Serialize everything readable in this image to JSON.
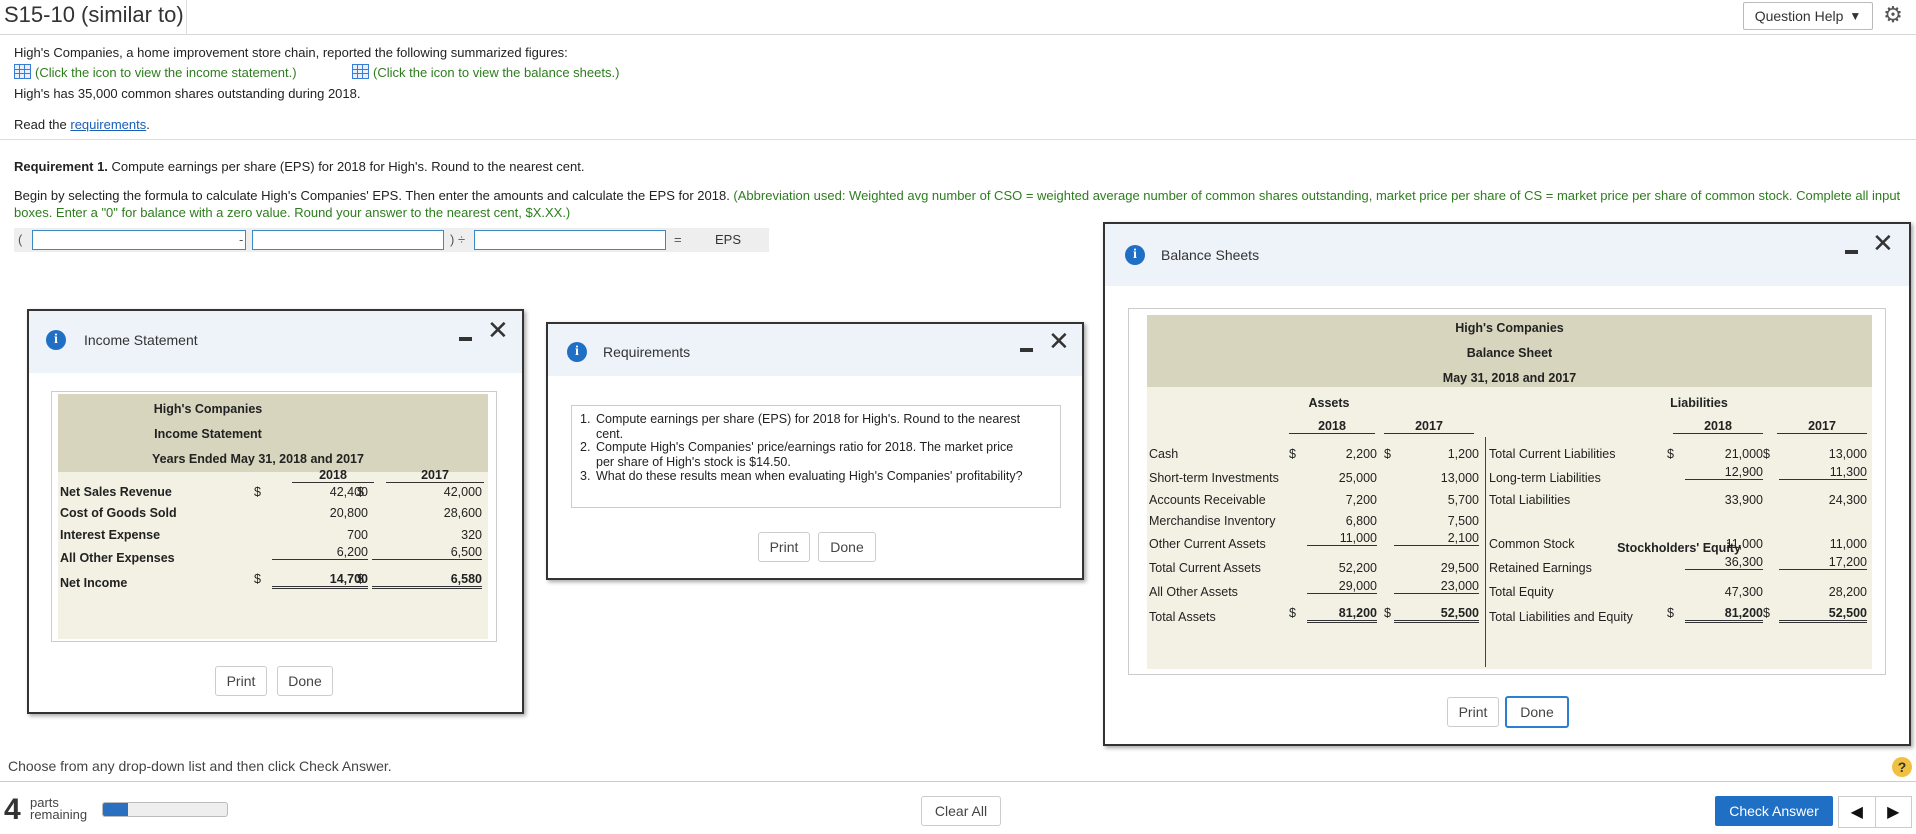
{
  "header": {
    "title": "S15-10 (similar to)",
    "question_help": "Question Help",
    "question_help_caret": "▼",
    "gear_icon": "⚙"
  },
  "problem": {
    "intro": "High's Companies, a home improvement store chain, reported the following summarized figures:",
    "link_income": "(Click the icon to view the income statement.)",
    "link_balance": "(Click the icon to view the balance sheets.)",
    "shares_text": "High's has 35,000 common shares outstanding during 2018.",
    "read_the": "Read the ",
    "requirements_link": "requirements",
    "period": "."
  },
  "requirement": {
    "label": "Requirement 1.",
    "text": " Compute earnings per share (EPS) for 2018 for High's. Round to the nearest cent.",
    "instr_black": "Begin by selecting the formula to calculate High's Companies' EPS. Then enter the amounts and calculate the EPS for 2018.",
    "instr_green_1": " (Abbreviation used: Weighted avg number of CSO = weighted average number of common shares outstanding, market price per share of CS = market price per share of common stock. Complete all input",
    "instr_green_2": "boxes. Enter a \"0\" for balance with a zero value. Round your answer to the nearest cent, $X.XX.)"
  },
  "formula": {
    "open_paren": "(",
    "minus": "-",
    "close_div": ") ÷",
    "equals": "=",
    "result_label": "EPS"
  },
  "income_dialog": {
    "title": "Income Statement",
    "company": "High's Companies",
    "statement": "Income Statement",
    "period": "Years Ended May 31, 2018 and 2017",
    "years": [
      "2018",
      "2017"
    ],
    "rows": [
      {
        "label": "Net Sales Revenue",
        "s1": "$",
        "v2018": "42,400",
        "s2": "$",
        "v2017": "42,000"
      },
      {
        "label": "Cost of Goods Sold",
        "s1": "",
        "v2018": "20,800",
        "s2": "",
        "v2017": "28,600"
      },
      {
        "label": "Interest Expense",
        "s1": "",
        "v2018": "700",
        "s2": "",
        "v2017": "320"
      },
      {
        "label": "All Other Expenses",
        "s1": "",
        "v2018": "6,200",
        "s2": "",
        "v2017": "6,500"
      },
      {
        "label": "Net Income",
        "s1": "$",
        "v2018": "14,700",
        "s2": "$",
        "v2017": "6,580"
      }
    ],
    "print": "Print",
    "done": "Done"
  },
  "requirements_dialog": {
    "title": "Requirements",
    "items": [
      {
        "num": "1.",
        "line1": "Compute earnings per share (EPS) for 2018 for High's. Round to the nearest",
        "line2": "cent."
      },
      {
        "num": "2.",
        "line1": "Compute High's Companies' price/earnings ratio for 2018. The market price",
        "line2": "per share of High's stock is $14.50."
      },
      {
        "num": "3.",
        "line1": "What do these results mean when evaluating High's Companies' profitability?",
        "line2": ""
      }
    ],
    "print": "Print",
    "done": "Done"
  },
  "balance_dialog": {
    "title": "Balance Sheets",
    "company": "High's Companies",
    "statement": "Balance Sheet",
    "period": "May 31, 2018 and 2017",
    "assets_header": "Assets",
    "liabilities_header": "Liabilities",
    "equity_header": "Stockholders' Equity",
    "years": [
      "2018",
      "2017"
    ],
    "assets": [
      {
        "label": "Cash",
        "s1": "$",
        "v2018": "2,200",
        "s2": "$",
        "v2017": "1,200"
      },
      {
        "label": "Short-term Investments",
        "s1": "",
        "v2018": "25,000",
        "s2": "",
        "v2017": "13,000"
      },
      {
        "label": "Accounts Receivable",
        "s1": "",
        "v2018": "7,200",
        "s2": "",
        "v2017": "5,700"
      },
      {
        "label": "Merchandise Inventory",
        "s1": "",
        "v2018": "6,800",
        "s2": "",
        "v2017": "7,500"
      },
      {
        "label": "Other Current Assets",
        "s1": "",
        "v2018": "11,000",
        "s2": "",
        "v2017": "2,100"
      },
      {
        "label": "Total Current Assets",
        "s1": "",
        "v2018": "52,200",
        "s2": "",
        "v2017": "29,500"
      },
      {
        "label": "All Other Assets",
        "s1": "",
        "v2018": "29,000",
        "s2": "",
        "v2017": "23,000"
      },
      {
        "label": "Total Assets",
        "s1": "$",
        "v2018": "81,200",
        "s2": "$",
        "v2017": "52,500"
      }
    ],
    "liabilities": [
      {
        "label": "Total Current Liabilities",
        "s1": "$",
        "v2018": "21,000",
        "s2": "$",
        "v2017": "13,000"
      },
      {
        "label": "Long-term Liabilities",
        "s1": "",
        "v2018": "12,900",
        "s2": "",
        "v2017": "11,300"
      },
      {
        "label": "Total Liabilities",
        "s1": "",
        "v2018": "33,900",
        "s2": "",
        "v2017": "24,300"
      }
    ],
    "equity": [
      {
        "label": "Common Stock",
        "s1": "",
        "v2018": "11,000",
        "s2": "",
        "v2017": "11,000"
      },
      {
        "label": "Retained Earnings",
        "s1": "",
        "v2018": "36,300",
        "s2": "",
        "v2017": "17,200"
      },
      {
        "label": "Total Equity",
        "s1": "",
        "v2018": "47,300",
        "s2": "",
        "v2017": "28,200"
      },
      {
        "label": "Total Liabilities and Equity",
        "s1": "$",
        "v2018": "81,200",
        "s2": "$",
        "v2017": "52,500"
      }
    ],
    "print": "Print",
    "done": "Done"
  },
  "footer": {
    "choose_text": "Choose from any drop-down list and then click Check Answer.",
    "help_icon": "?",
    "parts_number": "4",
    "parts_label_1": "parts",
    "parts_label_2": "remaining",
    "progress_fraction": 0.2,
    "clear_all": "Clear All",
    "check_answer": "Check Answer",
    "prev_icon": "◀",
    "next_icon": "▶"
  }
}
